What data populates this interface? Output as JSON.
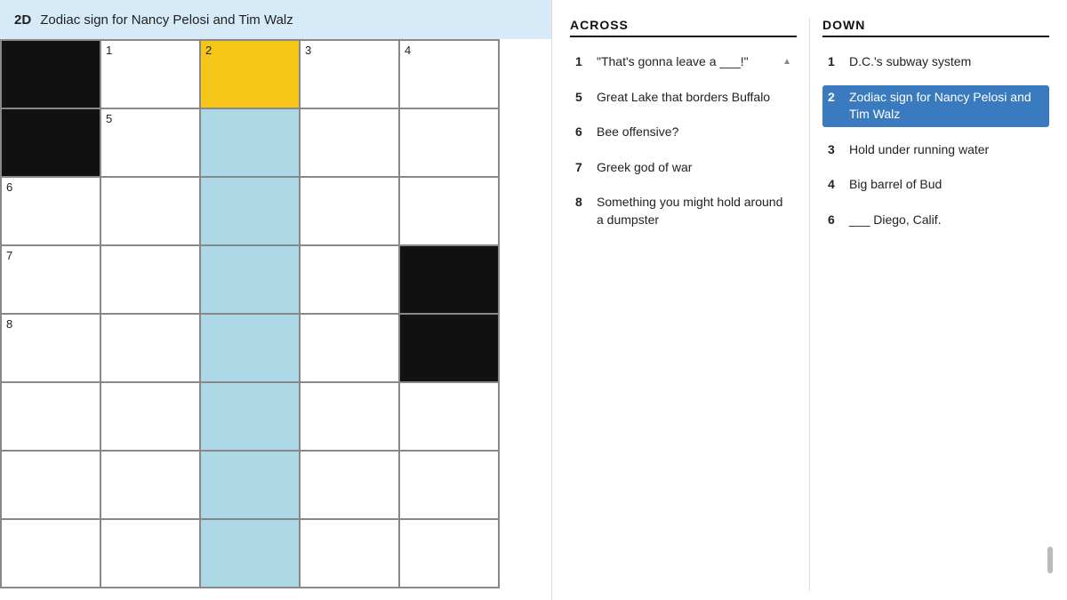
{
  "clue_bar": {
    "number": "2D",
    "text": "Zodiac sign for Nancy Pelosi and Tim Walz"
  },
  "grid": {
    "rows": 8,
    "cols": 5,
    "cells": [
      {
        "row": 0,
        "col": 0,
        "type": "black"
      },
      {
        "row": 0,
        "col": 1,
        "number": "1",
        "type": "white"
      },
      {
        "row": 0,
        "col": 2,
        "number": "2",
        "type": "yellow"
      },
      {
        "row": 0,
        "col": 3,
        "number": "3",
        "type": "white"
      },
      {
        "row": 0,
        "col": 4,
        "number": "4",
        "type": "white"
      },
      {
        "row": 1,
        "col": 0,
        "type": "black"
      },
      {
        "row": 1,
        "col": 1,
        "number": "5",
        "type": "white"
      },
      {
        "row": 1,
        "col": 2,
        "type": "blue"
      },
      {
        "row": 1,
        "col": 3,
        "type": "white"
      },
      {
        "row": 1,
        "col": 4,
        "type": "white"
      },
      {
        "row": 2,
        "col": 0,
        "number": "6",
        "type": "white"
      },
      {
        "row": 2,
        "col": 1,
        "type": "white"
      },
      {
        "row": 2,
        "col": 2,
        "type": "blue"
      },
      {
        "row": 2,
        "col": 3,
        "type": "white"
      },
      {
        "row": 2,
        "col": 4,
        "type": "white"
      },
      {
        "row": 3,
        "col": 0,
        "number": "7",
        "type": "white"
      },
      {
        "row": 3,
        "col": 1,
        "type": "white"
      },
      {
        "row": 3,
        "col": 2,
        "type": "blue"
      },
      {
        "row": 3,
        "col": 3,
        "type": "white"
      },
      {
        "row": 3,
        "col": 4,
        "type": "black"
      },
      {
        "row": 4,
        "col": 0,
        "number": "8",
        "type": "white"
      },
      {
        "row": 4,
        "col": 1,
        "type": "white"
      },
      {
        "row": 4,
        "col": 2,
        "type": "blue"
      },
      {
        "row": 4,
        "col": 3,
        "type": "white"
      },
      {
        "row": 4,
        "col": 4,
        "type": "black"
      },
      {
        "row": 5,
        "col": 0,
        "type": "white"
      },
      {
        "row": 5,
        "col": 1,
        "type": "white"
      },
      {
        "row": 5,
        "col": 2,
        "type": "blue"
      },
      {
        "row": 5,
        "col": 3,
        "type": "white"
      },
      {
        "row": 5,
        "col": 4,
        "type": "white"
      },
      {
        "row": 6,
        "col": 0,
        "type": "white"
      },
      {
        "row": 6,
        "col": 1,
        "type": "white"
      },
      {
        "row": 6,
        "col": 2,
        "type": "blue"
      },
      {
        "row": 6,
        "col": 3,
        "type": "white"
      },
      {
        "row": 6,
        "col": 4,
        "type": "white"
      },
      {
        "row": 7,
        "col": 0,
        "type": "white"
      },
      {
        "row": 7,
        "col": 1,
        "type": "white"
      },
      {
        "row": 7,
        "col": 2,
        "type": "blue"
      },
      {
        "row": 7,
        "col": 3,
        "type": "white"
      },
      {
        "row": 7,
        "col": 4,
        "type": "white"
      }
    ]
  },
  "across": {
    "title": "ACROSS",
    "clues": [
      {
        "number": "1",
        "text": "\"That's gonna leave a ___!\"",
        "has_sort": true
      },
      {
        "number": "5",
        "text": "Great Lake that borders Buffalo"
      },
      {
        "number": "6",
        "text": "Bee offensive?"
      },
      {
        "number": "7",
        "text": "Greek god of war"
      },
      {
        "number": "8",
        "text": "Something you might hold around a dumpster"
      }
    ]
  },
  "down": {
    "title": "DOWN",
    "clues": [
      {
        "number": "1",
        "text": "D.C.'s subway system"
      },
      {
        "number": "2",
        "text": "Zodiac sign for Nancy Pelosi and Tim Walz",
        "highlighted": true
      },
      {
        "number": "3",
        "text": "Hold under running water"
      },
      {
        "number": "4",
        "text": "Big barrel of Bud"
      },
      {
        "number": "6",
        "text": "___ Diego, Calif."
      }
    ]
  }
}
